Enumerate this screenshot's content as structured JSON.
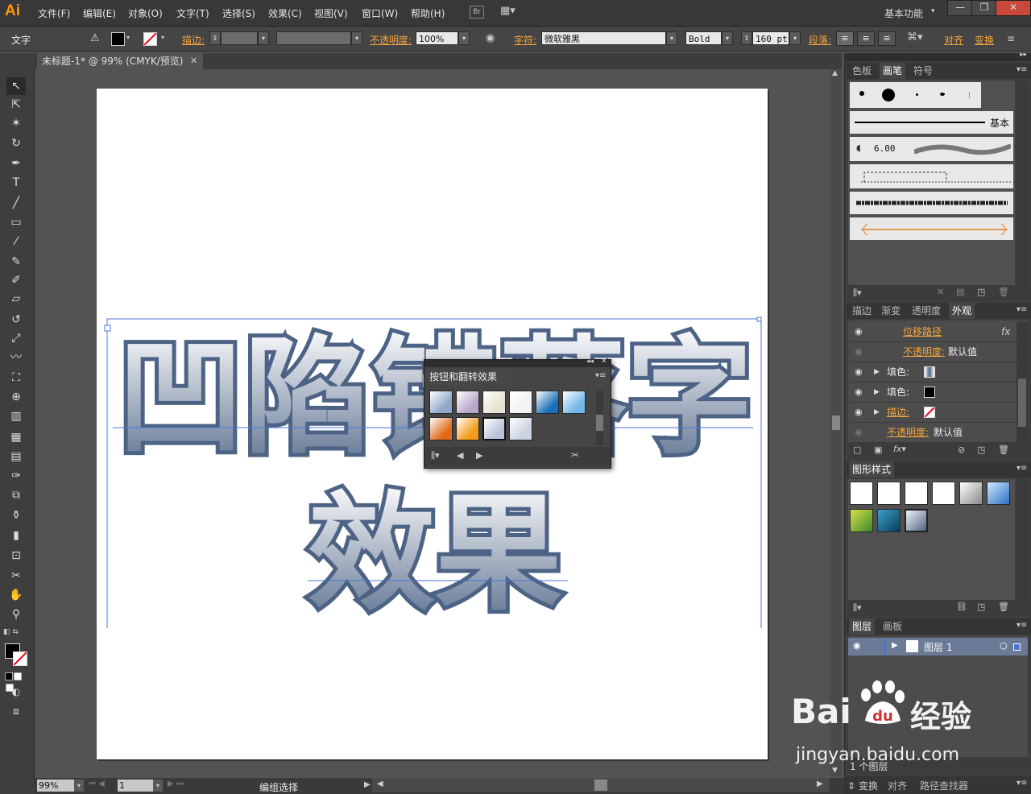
{
  "app": {
    "logo": "Ai",
    "workspace": "基本功能"
  },
  "menu": [
    "文件(F)",
    "编辑(E)",
    "对象(O)",
    "文字(T)",
    "选择(S)",
    "效果(C)",
    "视图(V)",
    "窗口(W)",
    "帮助(H)"
  ],
  "bridge_label": "Br",
  "window_buttons": [
    "—",
    "❐",
    "✕"
  ],
  "control": {
    "tool_name": "文字",
    "stroke_label": "描边:",
    "opacity_label": "不透明度:",
    "opacity_value": "100%",
    "char_label": "字符:",
    "font_family": "微软雅黑",
    "font_style": "Bold",
    "font_size": "160 pt",
    "paragraph_label": "段落:",
    "align_label": "对齐",
    "transform_label": "变换"
  },
  "doc_tab": {
    "title": "未标题-1* @ 99% (CMYK/预览)",
    "close": "✕"
  },
  "artwork": {
    "line1": "凹陷错落字",
    "line2": "效果",
    "fill_top": "#ffffff",
    "fill_bottom": "#5b6f8e",
    "outline": "#4d6386"
  },
  "float_panel": {
    "title": "按钮和翻转效果",
    "swatches": [
      "#8fa7c8",
      "#b7a9c9",
      "#e7e2d0",
      "#f2f2f6",
      "#1b6fb8",
      "#74b6e8",
      "#e06a1a",
      "#f39a1a",
      "#b9c2d8",
      "#c9d1e2"
    ]
  },
  "panels": {
    "color_tabs": [
      "色板",
      "画笔",
      "符号"
    ],
    "brush_size_label": "6.00",
    "brush_basic_label": "基本",
    "appearance_tabs": [
      "描边",
      "渐变",
      "透明度",
      "外观"
    ],
    "appearance_rows": [
      {
        "label": "位移路径",
        "orange": true,
        "value": "",
        "fx": "fx"
      },
      {
        "label": "不透明度:",
        "orange": true,
        "value": "默认值"
      },
      {
        "label": "填色:",
        "orange": false,
        "value": ""
      },
      {
        "label": "填色:",
        "orange": false,
        "value": ""
      },
      {
        "label": "描边:",
        "orange": true,
        "value": ""
      },
      {
        "label": "不透明度:",
        "orange": true,
        "value": "默认值"
      }
    ],
    "graphic_styles_title": "图形样式",
    "layers_tabs": [
      "图层",
      "画板"
    ],
    "layer_name": "图层 1",
    "layers_count": "1 个图层",
    "bottom_tabs": [
      "变换",
      "对齐",
      "路径查找器"
    ]
  },
  "status": {
    "zoom": "99%",
    "page": "1",
    "message": "编组选择"
  },
  "watermark": {
    "brand": "Bai",
    "brand2": "du",
    "cn": "经验",
    "url": "jingyan.baidu.com"
  }
}
